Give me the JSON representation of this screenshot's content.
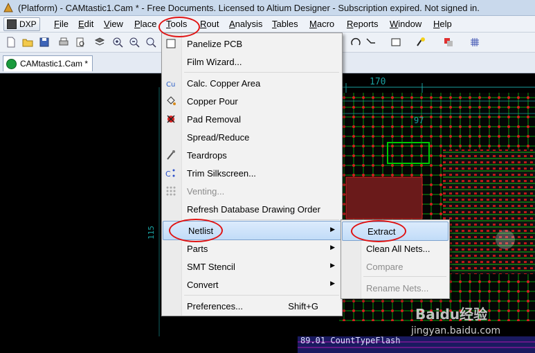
{
  "window": {
    "title": "(Platform) - CAMtastic1.Cam * - Free Documents. Licensed to Altium Designer - Subscription expired. Not signed in."
  },
  "menubar": {
    "dxp_label": "DXP",
    "items": [
      {
        "label": "File",
        "mn": "F",
        "rest": "ile"
      },
      {
        "label": "Edit",
        "mn": "E",
        "rest": "dit"
      },
      {
        "label": "View",
        "mn": "V",
        "rest": "iew"
      },
      {
        "label": "Place",
        "mn": "P",
        "rest": "lace"
      },
      {
        "label": "Tools",
        "mn": "T",
        "rest": "ools"
      },
      {
        "label": "Rout",
        "mn": "R",
        "rest": "out"
      },
      {
        "label": "Analysis",
        "mn": "A",
        "rest": "nalysis"
      },
      {
        "label": "Tables",
        "mn": "T",
        "rest": "ables"
      },
      {
        "label": "Macro",
        "mn": "M",
        "rest": "acro"
      },
      {
        "label": "Reports",
        "mn": "R",
        "rest": "eports"
      },
      {
        "label": "Window",
        "mn": "W",
        "rest": "indow"
      },
      {
        "label": "Help",
        "mn": "H",
        "rest": "elp"
      }
    ]
  },
  "doc_tab": {
    "label": "CAMtastic1.Cam *"
  },
  "tools_menu": {
    "items": [
      {
        "label": "Panelize PCB",
        "icon": "checkbox-icon"
      },
      {
        "label": "Film Wizard...",
        "icon": ""
      },
      {
        "label": "Calc. Copper Area",
        "icon": "copper-area-icon"
      },
      {
        "label": "Copper Pour",
        "icon": "paint-bucket-icon"
      },
      {
        "label": "Pad Removal",
        "icon": "pad-removal-icon"
      },
      {
        "label": "Spread/Reduce",
        "icon": ""
      },
      {
        "label": "Teardrops",
        "icon": "teardrop-icon"
      },
      {
        "label": "Trim Silkscreen...",
        "icon": "trim-silkscreen-icon"
      },
      {
        "label": "Venting...",
        "icon": "venting-icon",
        "disabled": true
      },
      {
        "label": "Refresh Database Drawing Order",
        "icon": ""
      },
      {
        "label": "Netlist",
        "icon": "",
        "submenu": true,
        "highlighted": true
      },
      {
        "label": "Parts",
        "icon": "",
        "submenu": true
      },
      {
        "label": "SMT Stencil",
        "icon": "",
        "submenu": true
      },
      {
        "label": "Convert",
        "icon": "",
        "submenu": true
      },
      {
        "label": "Preferences...",
        "icon": "",
        "shortcut": "Shift+G"
      }
    ]
  },
  "netlist_submenu": {
    "items": [
      {
        "label": "Extract",
        "highlighted": true
      },
      {
        "label": "Clean All Nets..."
      },
      {
        "label": "Compare",
        "disabled": true
      },
      {
        "label": "Rename Nets...",
        "disabled": true
      }
    ]
  },
  "pcb_labels": {
    "dim_top": "170",
    "dim_left": "115",
    "dim_mid": "97",
    "bottom_text": "89.01 CountTypeFlash"
  },
  "watermark": {
    "brand": "Baidu",
    "brand_cn": "经验",
    "url": "jingyan.baidu.com"
  },
  "colors": {
    "highlight": "#c1dcf8",
    "annotation": "#e01414",
    "pcb_green": "#00c800",
    "pcb_red": "#d62020"
  }
}
